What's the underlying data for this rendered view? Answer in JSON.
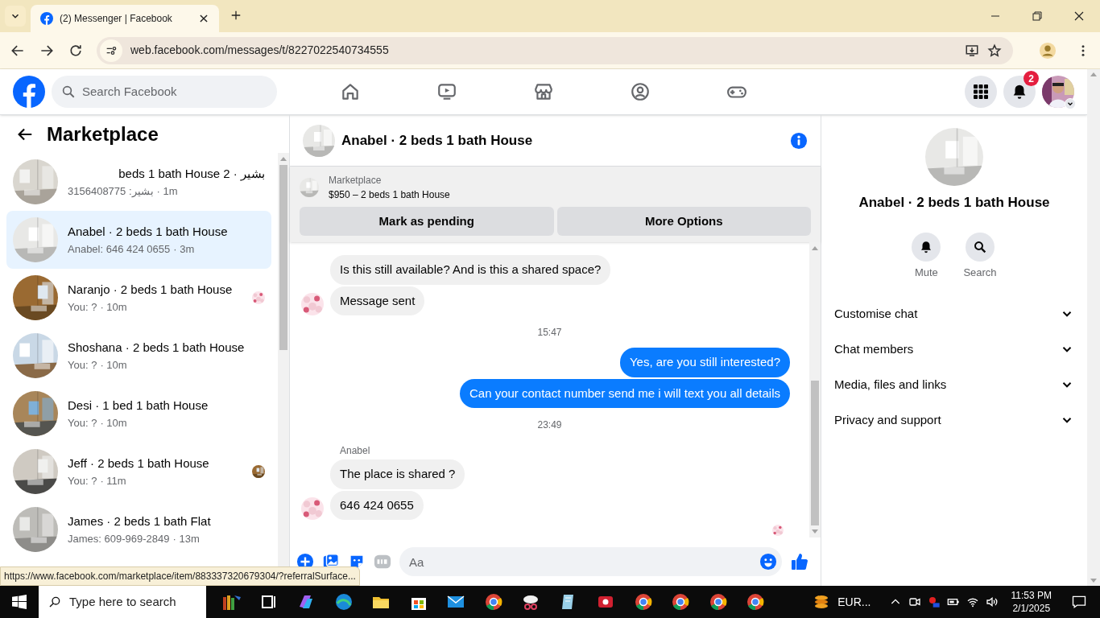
{
  "browser": {
    "tab_title": "(2) Messenger | Facebook",
    "url": "web.facebook.com/messages/t/8227022540734555",
    "status_url": "https://www.facebook.com/marketplace/item/883337320679304/?referralSurface..."
  },
  "header": {
    "search_placeholder": "Search Facebook",
    "notification_count": "2"
  },
  "sidebar": {
    "title": "Marketplace",
    "conversations": [
      {
        "title": "بشير · 2 beds 1 bath House",
        "preview": "بشير: 3156408775",
        "time": "· 1m",
        "selected": false,
        "seen_avatar": false
      },
      {
        "title": "Anabel · 2 beds 1 bath House",
        "preview": "Anabel: 646 424 0655",
        "time": "· 3m",
        "selected": true,
        "seen_avatar": false
      },
      {
        "title": "Naranjo · 2 beds 1 bath House",
        "preview": "You: ?",
        "time": "· 10m",
        "selected": false,
        "seen_avatar": true
      },
      {
        "title": "Shoshana · 2 beds 1 bath House",
        "preview": "You: ?",
        "time": "· 10m",
        "selected": false,
        "seen_avatar": false
      },
      {
        "title": "Desi · 1 bed 1 bath House",
        "preview": "You: ?",
        "time": "· 10m",
        "selected": false,
        "seen_avatar": false
      },
      {
        "title": "Jeff · 2 beds 1 bath House",
        "preview": "You: ?",
        "time": "· 11m",
        "selected": false,
        "seen_avatar": true
      },
      {
        "title": "James · 2 beds 1 bath Flat",
        "preview": "James: 609-969-2849",
        "time": "· 13m",
        "selected": false,
        "seen_avatar": false
      }
    ]
  },
  "chat": {
    "title": "Anabel · 2 beds 1 bath House",
    "listing": {
      "label": "Marketplace",
      "text": "$950 – 2 beds 1 bath House"
    },
    "buttons": [
      "Mark as pending",
      "More Options"
    ],
    "messages": [
      {
        "kind": "incoming",
        "text": "Is this still available? And is this a shared space?",
        "avatar": false
      },
      {
        "kind": "incoming",
        "text": "Message sent",
        "avatar": true
      },
      {
        "kind": "time",
        "text": "15:47"
      },
      {
        "kind": "outgoing",
        "text": "Yes, are you still interested?"
      },
      {
        "kind": "outgoing",
        "text": "Can your contact number send me i will text you all details"
      },
      {
        "kind": "time",
        "text": "23:49"
      },
      {
        "kind": "sender",
        "text": "Anabel"
      },
      {
        "kind": "incoming",
        "text": "The place is shared ?",
        "avatar": false
      },
      {
        "kind": "incoming",
        "text": "646 424 0655",
        "avatar": true
      },
      {
        "kind": "seen"
      }
    ],
    "composer_placeholder": "Aa"
  },
  "details": {
    "name": "Anabel · 2 beds 1 bath House",
    "actions": [
      {
        "kind": "bell",
        "label": "Mute"
      },
      {
        "kind": "search",
        "label": "Search"
      }
    ],
    "sections": [
      {
        "label": "Customise chat",
        "expanded": false
      },
      {
        "label": "Chat members",
        "expanded": false
      },
      {
        "label": "Media, files and links",
        "expanded": false
      },
      {
        "label": "Privacy and support",
        "expanded": false
      }
    ]
  },
  "taskbar": {
    "search_placeholder": "Type here to search",
    "tray_text": "EUR...",
    "time": "11:53 PM",
    "date": "2/1/2025"
  }
}
